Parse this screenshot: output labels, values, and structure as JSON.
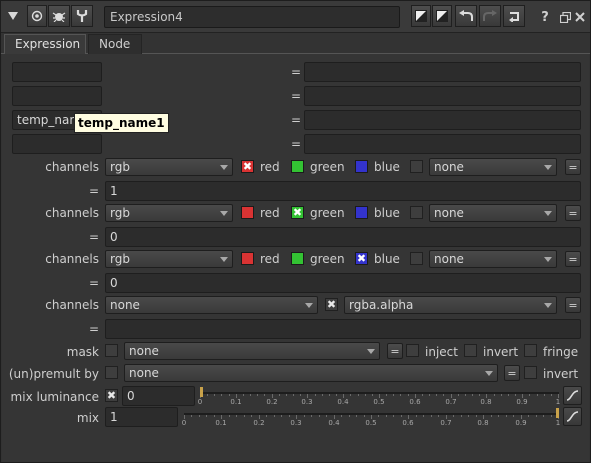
{
  "window": {
    "node_name": "Expression4"
  },
  "tabs": [
    "Expression",
    "Node"
  ],
  "temp_rows": [
    {
      "name": "",
      "expression": ""
    },
    {
      "name": "",
      "expression": ""
    },
    {
      "name": "temp_name1",
      "expression": ""
    },
    {
      "name": "",
      "expression": ""
    }
  ],
  "equals": "=",
  "tooltip": "temp_name1",
  "channel_blocks": [
    {
      "label": "channels",
      "layer": "rgb",
      "red": {
        "label": "red",
        "checked": true,
        "color": "#d93333"
      },
      "green": {
        "label": "green",
        "checked": false,
        "color": "#33c233"
      },
      "blue": {
        "label": "blue",
        "checked": false,
        "color": "#3333cc"
      },
      "extra": "none",
      "expression": "1"
    },
    {
      "label": "channels",
      "layer": "rgb",
      "red": {
        "label": "red",
        "checked": false,
        "color": "#d93333"
      },
      "green": {
        "label": "green",
        "checked": true,
        "color": "#33c233"
      },
      "blue": {
        "label": "blue",
        "checked": false,
        "color": "#3333cc"
      },
      "extra": "none",
      "expression": "0"
    },
    {
      "label": "channels",
      "layer": "rgb",
      "red": {
        "label": "red",
        "checked": false,
        "color": "#d93333"
      },
      "green": {
        "label": "green",
        "checked": false,
        "color": "#33c233"
      },
      "blue": {
        "label": "blue",
        "checked": true,
        "color": "#3333cc"
      },
      "extra": "none",
      "expression": "0"
    }
  ],
  "alpha_block": {
    "label": "channels",
    "layer": "none",
    "channel": "rgba.alpha",
    "checked": true,
    "expression": ""
  },
  "mask": {
    "label": "mask",
    "value": "none",
    "inject": "inject",
    "invert": "invert",
    "fringe": "fringe"
  },
  "unpremult": {
    "label": "(un)premult by",
    "value": "none",
    "invert": "invert"
  },
  "mix_luminance": {
    "label": "mix luminance",
    "value": "0",
    "checked": true,
    "fraction": 0
  },
  "mix": {
    "label": "mix",
    "value": "1",
    "fraction": 1
  },
  "slider_ticks": [
    "0",
    "0.1",
    "0.2",
    "0.3",
    "0.4",
    "0.5",
    "0.6",
    "0.7",
    "0.8",
    "0.9",
    "1"
  ],
  "icons": {
    "collapse": "triangle-down-icon",
    "visibility": "circle-dot-icon",
    "bug": "bug-icon",
    "wrench": "wrench-icon",
    "help": "question-icon",
    "float": "float-window-icon",
    "close": "close-icon"
  }
}
